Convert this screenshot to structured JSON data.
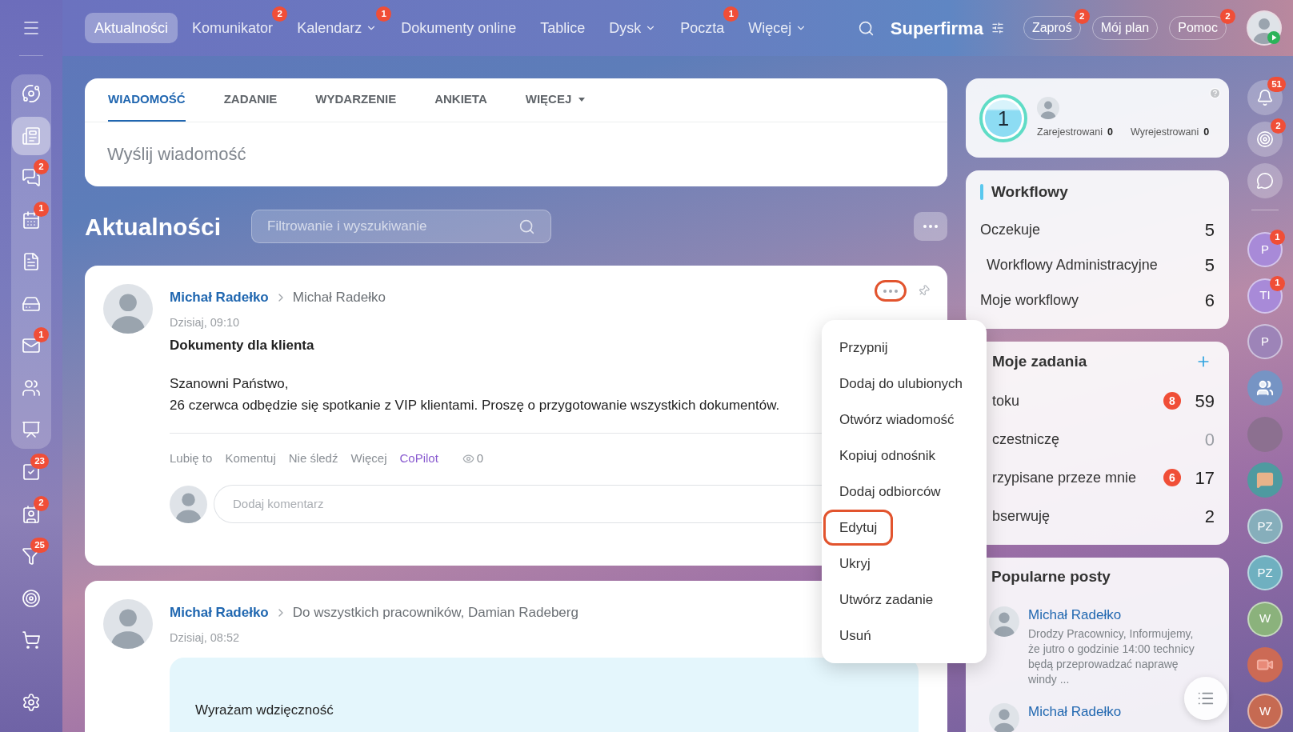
{
  "sidebar": {
    "items": [
      {
        "kind": "flow",
        "selected": false
      },
      {
        "kind": "news",
        "selected": true
      },
      {
        "kind": "chat",
        "selected": false,
        "badge": "2"
      },
      {
        "kind": "calendar",
        "selected": false,
        "badge": "1"
      },
      {
        "kind": "document",
        "selected": false
      },
      {
        "kind": "drive",
        "selected": false
      },
      {
        "kind": "mail",
        "selected": false,
        "badge": "1"
      },
      {
        "kind": "people",
        "selected": false
      },
      {
        "kind": "board",
        "selected": false
      }
    ],
    "more_items": [
      {
        "kind": "tasks",
        "selected": false,
        "badge": "23"
      },
      {
        "kind": "crm",
        "selected": false,
        "badge": "2"
      },
      {
        "kind": "funnel",
        "selected": false,
        "badge": "25"
      },
      {
        "kind": "goals",
        "selected": false
      },
      {
        "kind": "shop",
        "selected": false
      }
    ]
  },
  "topbar": {
    "nav": [
      {
        "label": "Aktualności",
        "selected": true,
        "dropdown": false
      },
      {
        "label": "Komunikator",
        "selected": false,
        "dropdown": false,
        "badge": "2"
      },
      {
        "label": "Kalendarz",
        "selected": false,
        "dropdown": true,
        "badge": "1"
      },
      {
        "label": "Dokumenty online",
        "selected": false,
        "dropdown": false
      },
      {
        "label": "Tablice",
        "selected": false,
        "dropdown": false
      },
      {
        "label": "Dysk",
        "selected": false,
        "dropdown": true
      },
      {
        "label": "Poczta",
        "selected": false,
        "dropdown": false,
        "badge": "1"
      },
      {
        "label": "Więcej",
        "selected": false,
        "dropdown": true
      }
    ],
    "company": "Superfirma",
    "buttons": [
      {
        "label": "Zaproś",
        "badge": "2"
      },
      {
        "label": "Mój plan"
      },
      {
        "label": "Pomoc",
        "badge": "2"
      }
    ]
  },
  "composer": {
    "tabs": [
      {
        "label": "WIADOMOŚĆ",
        "selected": true,
        "dropdown": false
      },
      {
        "label": "ZADANIE",
        "selected": false,
        "dropdown": false
      },
      {
        "label": "WYDARZENIE",
        "selected": false,
        "dropdown": false
      },
      {
        "label": "ANKIETA",
        "selected": false,
        "dropdown": false
      },
      {
        "label": "WIĘCEJ",
        "selected": false,
        "dropdown": true
      }
    ],
    "placeholder": "Wyślij wiadomość"
  },
  "feed": {
    "title": "Aktualności",
    "filter": {
      "placeholder": "Filtrowanie i wyszukiwanie"
    },
    "posts": [
      {
        "author": "Michał Radełko",
        "recipients": "Michał Radełko",
        "date": "Dzisiaj, 09:10",
        "more_highlighted": true,
        "title": "Dokumenty dla klienta",
        "body": [
          "Szanowni Państwo,",
          "26 czerwca odbędzie się spotkanie z VIP klientami. Proszę o przygotowanie wszystkich dokumentów."
        ],
        "actions": [
          {
            "label": "Lubię to",
            "kind": "plain"
          },
          {
            "label": "Komentuj",
            "kind": "plain"
          },
          {
            "label": "Nie śledź",
            "kind": "plain"
          },
          {
            "label": "Więcej",
            "kind": "plain"
          },
          {
            "label": "CoPilot",
            "kind": "ai"
          }
        ],
        "views": "0",
        "comment_placeholder": "Dodaj komentarz"
      },
      {
        "author": "Michał Radełko",
        "recipients": "Do wszystkich pracowników, Damian Radeberg",
        "date": "Dzisiaj, 08:52",
        "card_text": "Wyrażam wdzięczność"
      }
    ]
  },
  "context_menu": {
    "items": [
      {
        "label": "Przypnij",
        "highlighted": false
      },
      {
        "label": "Dodaj do ulubionych",
        "highlighted": false
      },
      {
        "label": "Otwórz wiadomość",
        "highlighted": false
      },
      {
        "label": "Kopiuj odnośnik",
        "highlighted": false
      },
      {
        "label": "Dodaj odbiorców",
        "highlighted": false
      },
      {
        "label": "Edytuj",
        "highlighted": true
      },
      {
        "label": "Ukryj",
        "highlighted": false
      },
      {
        "label": "Utwórz zadanie",
        "highlighted": false
      },
      {
        "label": "Usuń",
        "highlighted": false
      }
    ]
  },
  "stats": {
    "count": "1",
    "registered": {
      "label": "Zarejestrowani",
      "value": "0"
    },
    "unregistered": {
      "label": "Wyrejestrowani",
      "value": "0"
    }
  },
  "workflows": {
    "title": "Workflowy",
    "rows": [
      {
        "label": "Oczekuje",
        "value": "5",
        "children": [
          {
            "label": "Workflowy Administracyjne",
            "value": "5"
          }
        ]
      },
      {
        "label": "Moje workflowy",
        "value": "6"
      }
    ]
  },
  "tasks": {
    "title": "Moje zadania",
    "rows": [
      {
        "label": "toku",
        "badge": "8",
        "value": "59",
        "dimmed": false
      },
      {
        "label": "czestniczę",
        "value": "0",
        "dimmed": true
      },
      {
        "label": "rzypisane przeze mnie",
        "badge": "6",
        "value": "17",
        "dimmed": false
      },
      {
        "label": "bserwuję",
        "value": "2",
        "dimmed": false
      }
    ]
  },
  "popular": {
    "title": "Popularne posty",
    "posts": [
      {
        "author": "Michał Radełko",
        "excerpt": "Drodzy Pracownicy, Informujemy,\nże jutro o godzinie 14:00 technicy\nbędą przeprowadzać naprawę\nwindy ..."
      },
      {
        "author": "Michał Radełko"
      }
    ]
  },
  "rail": {
    "tools": [
      {
        "kind": "bell",
        "badge": "51"
      },
      {
        "kind": "target",
        "badge": "2"
      },
      {
        "kind": "sync"
      }
    ],
    "chats": [
      {
        "kind": "avatar",
        "initials": "P",
        "badge": "1",
        "color": "#a88ad8"
      },
      {
        "kind": "avatar",
        "initials": "TI",
        "badge": "1",
        "color": "#a88ad8"
      },
      {
        "kind": "avatar",
        "initials": "P",
        "color": "#9d84b8"
      },
      {
        "kind": "group",
        "color": "#7694c4"
      },
      {
        "kind": "photo"
      },
      {
        "kind": "channel",
        "color": "#4f9aa0"
      },
      {
        "kind": "avatar",
        "initials": "PZ",
        "color": "#86aebb"
      },
      {
        "kind": "avatar",
        "initials": "PZ",
        "color": "#6fb0c0"
      },
      {
        "kind": "avatar",
        "initials": "W",
        "color": "#8bb27c"
      },
      {
        "kind": "video",
        "color": "#cc6a55"
      },
      {
        "kind": "avatar",
        "initials": "W",
        "color": "#c66a52"
      }
    ]
  }
}
